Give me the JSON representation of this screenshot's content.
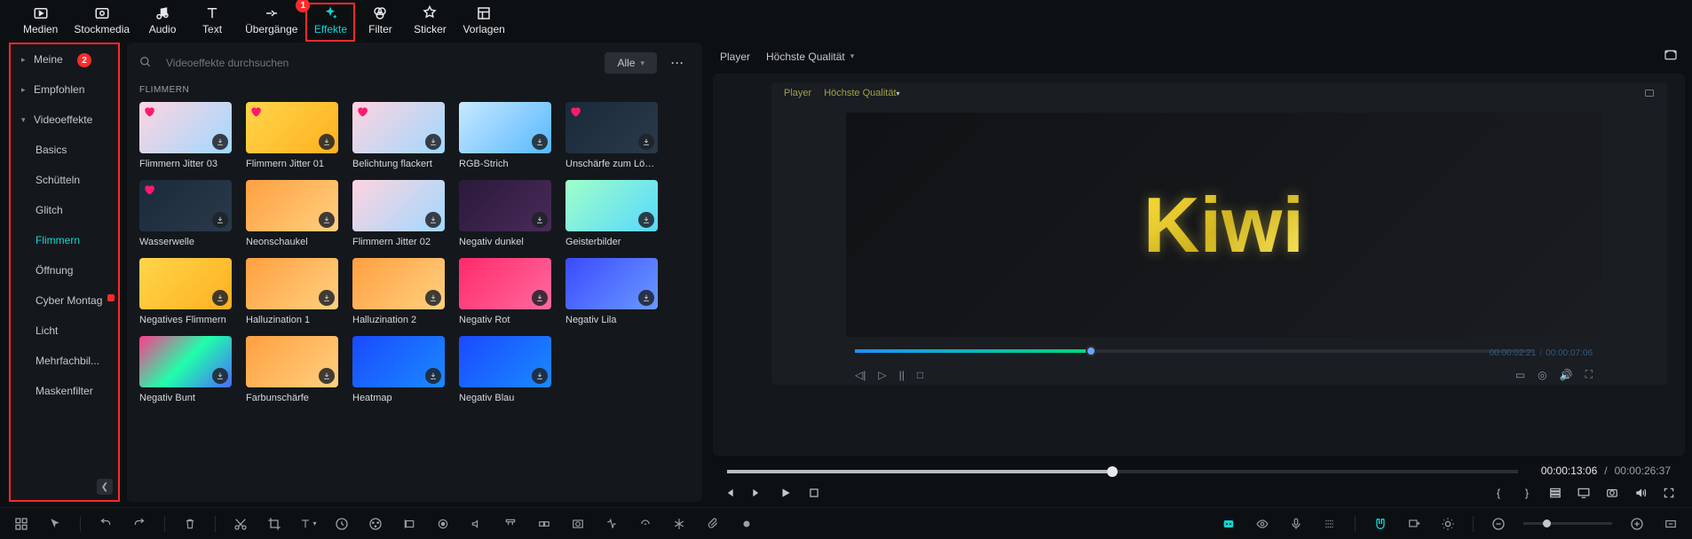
{
  "top_nav": [
    {
      "id": "medien",
      "label": "Medien"
    },
    {
      "id": "stockmedia",
      "label": "Stockmedia"
    },
    {
      "id": "audio",
      "label": "Audio"
    },
    {
      "id": "text",
      "label": "Text"
    },
    {
      "id": "uebergaenge",
      "label": "Übergänge",
      "callout": "1"
    },
    {
      "id": "effekte",
      "label": "Effekte",
      "active": true,
      "boxed": true
    },
    {
      "id": "filter",
      "label": "Filter"
    },
    {
      "id": "sticker",
      "label": "Sticker"
    },
    {
      "id": "vorlagen",
      "label": "Vorlagen"
    }
  ],
  "sidebar": {
    "callout": "2",
    "groups": [
      {
        "label": "Meine",
        "expandable": true
      },
      {
        "label": "Empfohlen",
        "expandable": true
      },
      {
        "label": "Videoeffekte",
        "expandable": true,
        "expanded": true
      }
    ],
    "subs": [
      {
        "label": "Basics"
      },
      {
        "label": "Schütteln"
      },
      {
        "label": "Glitch"
      },
      {
        "label": "Flimmern",
        "active": true
      },
      {
        "label": "Öffnung"
      },
      {
        "label": "Cyber Montag",
        "badge": true
      },
      {
        "label": "Licht"
      },
      {
        "label": "Mehrfachbil..."
      },
      {
        "label": "Maskenfilter"
      }
    ]
  },
  "search": {
    "placeholder": "Videoeffekte durchsuchen",
    "filter_label": "Alle"
  },
  "category_title": "FLIMMERN",
  "cards": [
    {
      "name": "Flimmern Jitter 03",
      "cls": "g1",
      "fav": true
    },
    {
      "name": "Flimmern Jitter 01",
      "cls": "g2",
      "fav": true
    },
    {
      "name": "Belichtung flackert",
      "cls": "g1",
      "fav": true
    },
    {
      "name": "RGB-Strich",
      "cls": "g3"
    },
    {
      "name": "Unschärfe zum Löschen",
      "cls": "g4",
      "fav": true
    },
    {
      "name": "Wasserwelle",
      "cls": "g4",
      "fav": true
    },
    {
      "name": "Neonschaukel",
      "cls": "g8"
    },
    {
      "name": "Flimmern Jitter 02",
      "cls": "g1"
    },
    {
      "name": "Negativ dunkel",
      "cls": "g9"
    },
    {
      "name": "Geisterbilder",
      "cls": "g7"
    },
    {
      "name": "Negatives Flimmern",
      "cls": "g2"
    },
    {
      "name": "Halluzination 1",
      "cls": "g8"
    },
    {
      "name": "Halluzination 2",
      "cls": "g8"
    },
    {
      "name": "Negativ Rot",
      "cls": "g5"
    },
    {
      "name": "Negativ Lila",
      "cls": "g6"
    },
    {
      "name": "Negativ Bunt",
      "cls": "g10"
    },
    {
      "name": "Farbunschärfe",
      "cls": "g8"
    },
    {
      "name": "Heatmap",
      "cls": "g11"
    },
    {
      "name": "Negativ Blau",
      "cls": "g11"
    }
  ],
  "preview": {
    "player_label": "Player",
    "quality_label": "Höchste Qualität",
    "inner_player_label": "Player",
    "inner_quality_label": "Höchste Qualität",
    "kiwi": "Kiwi",
    "inner_time_current": "00:00:02:21",
    "inner_time_total": "00:00:07:06",
    "outer_time_current": "00:00:13:06",
    "outer_time_total": "00:00:26:37"
  }
}
